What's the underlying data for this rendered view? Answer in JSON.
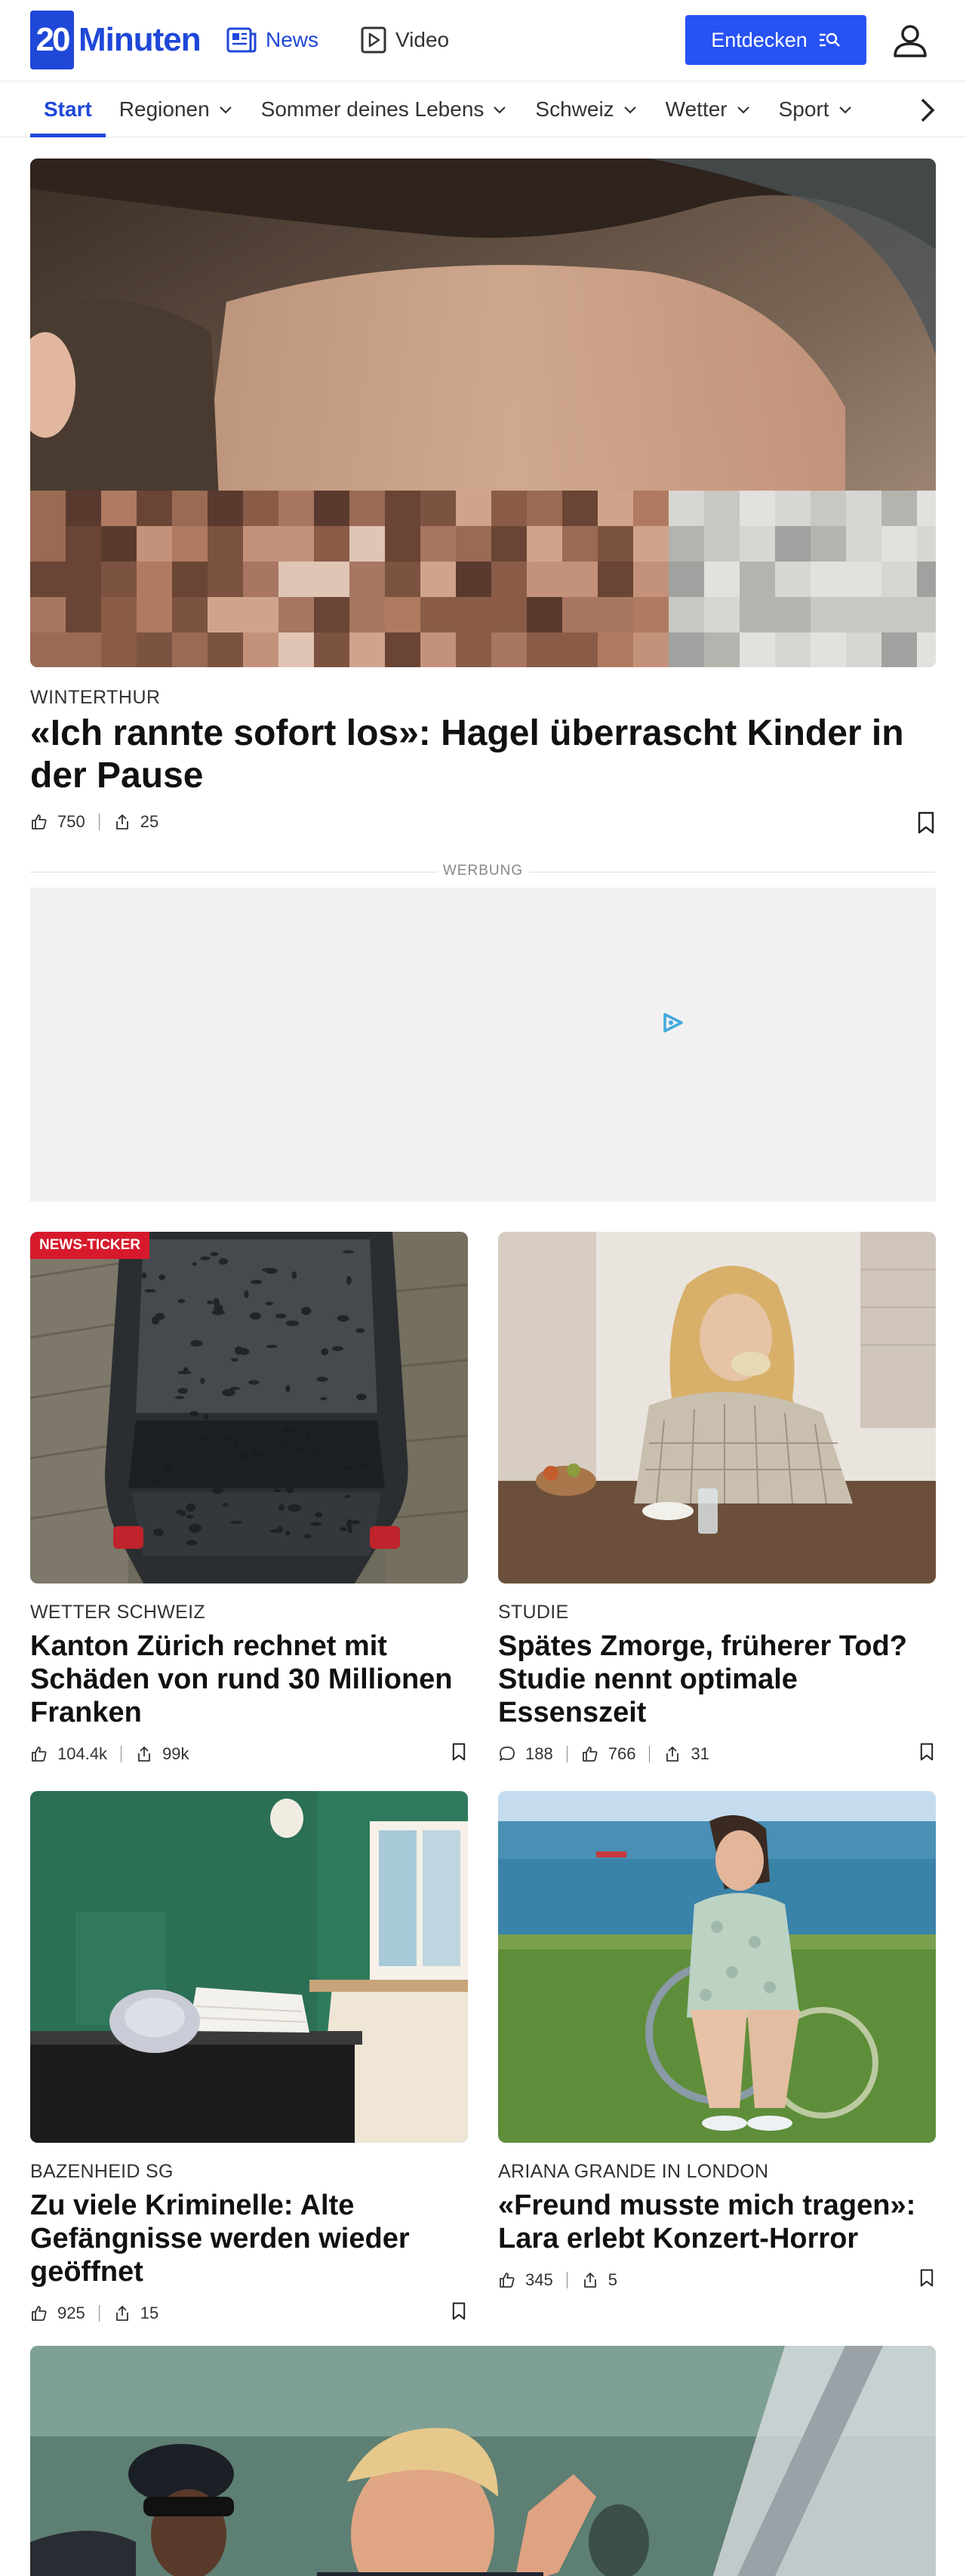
{
  "brand": {
    "logo_mark": "20",
    "logo_text": "Minuten"
  },
  "top_nav": [
    {
      "label": "News",
      "icon": "news-icon",
      "active": true
    },
    {
      "label": "Video",
      "icon": "video-play-icon",
      "active": false
    }
  ],
  "entdecken_label": "Entdecken",
  "categories": [
    {
      "label": "Start",
      "active": true,
      "has_dropdown": false
    },
    {
      "label": "Regionen",
      "active": false,
      "has_dropdown": true
    },
    {
      "label": "Sommer deines Lebens",
      "active": false,
      "has_dropdown": true
    },
    {
      "label": "Schweiz",
      "active": false,
      "has_dropdown": true
    },
    {
      "label": "Wetter",
      "active": false,
      "has_dropdown": true
    },
    {
      "label": "Sport",
      "active": false,
      "has_dropdown": true
    }
  ],
  "hero": {
    "kicker": "WINTERTHUR",
    "title": "«Ich rannte sofort los»: Hagel überrascht Kinder in der Pause",
    "likes": "750",
    "shares": "25"
  },
  "ad": {
    "label": "WERBUNG"
  },
  "cards": [
    {
      "badge": "NEWS-TICKER",
      "kicker": "WETTER SCHWEIZ",
      "title": "Kanton Zürich rechnet mit Schäden von rund 30 Millionen Franken",
      "comments": "",
      "likes": "104.4k",
      "shares": "99k"
    },
    {
      "badge": "",
      "kicker": "STUDIE",
      "title": "Spätes Zmorge, früherer Tod? Studie nennt optimale Essenszeit",
      "comments": "188",
      "likes": "766",
      "shares": "31"
    },
    {
      "badge": "",
      "kicker": "BAZENHEID SG",
      "title": "Zu viele Kriminelle: Alte Gefängnisse werden wieder geöffnet",
      "comments": "",
      "likes": "925",
      "shares": "15"
    },
    {
      "badge": "",
      "kicker": "ARIANA GRANDE IN LONDON",
      "title": "«Freund musste mich tragen»: Lara erlebt Konzert-Horror",
      "comments": "",
      "likes": "345",
      "shares": "5"
    }
  ],
  "colors": {
    "brand_blue": "#1f47d8",
    "button_blue": "#2752f4",
    "ticker_red": "#d61a2b",
    "ad_bg": "#f1f1f2"
  }
}
